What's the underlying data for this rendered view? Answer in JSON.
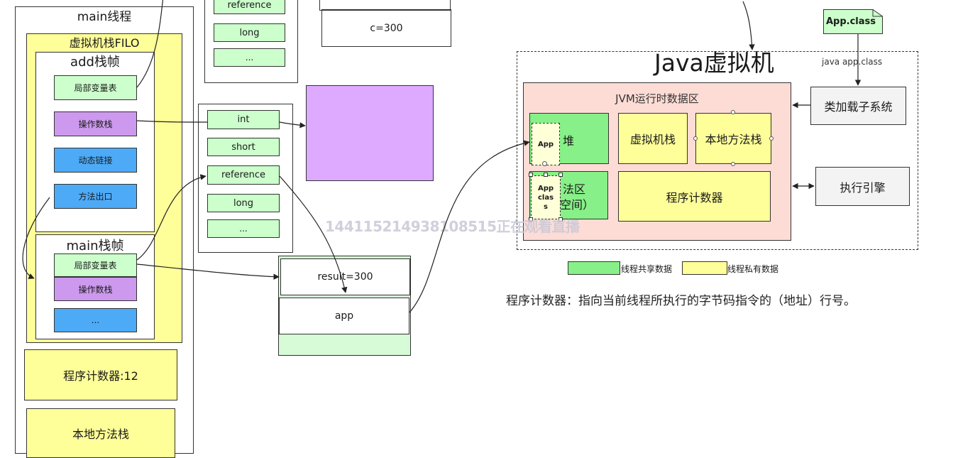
{
  "main_thread": {
    "title": "main线程",
    "vm_stack_title": "虚拟机栈FILO",
    "add_frame": {
      "title": "add栈帧",
      "items": [
        "局部变量表",
        "操作数栈",
        "动态链接",
        "方法出口"
      ]
    },
    "main_frame": {
      "title": "main栈帧",
      "items": [
        "局部变量表",
        "操作数栈",
        "..."
      ]
    },
    "program_counter": "程序计数器:12",
    "native_stack": "本地方法栈"
  },
  "top_slots": [
    "reference",
    "long",
    "..."
  ],
  "top_value": "c=300",
  "operand_slots": [
    "int",
    "short",
    "reference",
    "long",
    "..."
  ],
  "heap_obj": {
    "result": "result=300",
    "app": "app"
  },
  "jvm": {
    "title": "Java虚拟机",
    "runtime_title": "JVM运行时数据区",
    "heap": "堆",
    "method_area_line1": "法区",
    "method_area_line2": "空间）",
    "vm_stack": "虚拟机栈",
    "native_stack": "本地方法栈",
    "pc": "程序计数器",
    "app_obj": "App",
    "app_class_lines": [
      "App",
      "clas",
      "s"
    ]
  },
  "class_file": "App.class",
  "java_cmd": "java app.class",
  "class_loader": "类加载子系统",
  "exec_engine": "执行引擎",
  "legend": {
    "shared": "线程共享数据",
    "private": "线程私有数据"
  },
  "note": "程序计数器：指向当前线程所执行的字节码指令的（地址）行号。",
  "watermark": "1441152149381085​15正在观看直播",
  "colors": {
    "green": "#ccffcc",
    "purple": "#cc99ee",
    "blue": "#4daaf7",
    "yellow": "#ffff99",
    "jvm_pink": "#fddcd5",
    "heap_green": "#88f088",
    "big_purple": "#ddaaff"
  }
}
